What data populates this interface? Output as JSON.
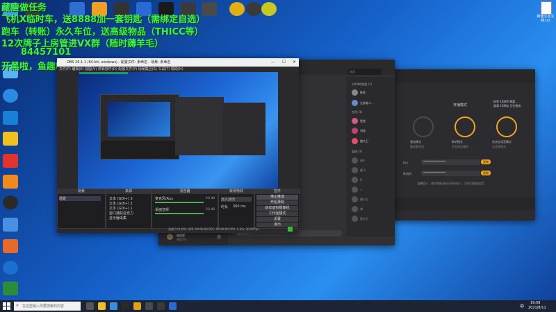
{
  "overlay": {
    "line1": "藏瘦做任务",
    "line2": "飞机X临时车，送8888加一套钥匙（需绑定自选）",
    "line3": "跑车（转账）永久车位，送高级物品（THICC等）",
    "line4": "12次牌子上房管进VX群（随时薅羊毛）",
    "line5": "84457101",
    "line6": "开黑啦，鱼趣啦啦鱼104"
  },
  "desktop_icons_left": [
    {
      "label": "",
      "color": "#3aa0e8"
    },
    {
      "label": "",
      "color": "#5ab4f0"
    },
    {
      "label": "",
      "color": "#1a7fd6"
    },
    {
      "label": "",
      "color": "#f0c020"
    },
    {
      "label": "",
      "color": "#e2332c"
    },
    {
      "label": "",
      "color": "#f08a20"
    },
    {
      "label": "",
      "color": "#2a2a2a"
    },
    {
      "label": "",
      "color": "#4a90e2"
    },
    {
      "label": "",
      "color": "#e86a2a"
    },
    {
      "label": "",
      "color": "#1a6fd0"
    },
    {
      "label": "",
      "color": "#2d8c3c"
    }
  ],
  "desktop_icons_top": [
    {
      "label": "",
      "color": "#e0b010"
    },
    {
      "label": "",
      "color": "#3a3a3a"
    },
    {
      "label": "",
      "color": "#c82020"
    },
    {
      "label": "",
      "color": "#ffffff"
    }
  ],
  "desktop_icon_right": {
    "label": "新建文本文档.txt"
  },
  "obs": {
    "title": "OBS 26.1.1 (64-bit, windows) - 配置文件: 未命名 - 场景: 未命名",
    "menu": "文件(F) 编辑(E) 视图(V) 停靠部件(D) 配置文件(P) 场景集合(S) 工具(T) 帮助(H)",
    "scenes_header": "场景",
    "sources_header": "来源",
    "mixer_header": "混音器",
    "transitions_header": "转场特效",
    "controls_header": "控件",
    "scene_item": "场景",
    "sources": [
      "文本 (GDI+) 3",
      "文本 (GDI+) 2",
      "文本 (GDI+) 1",
      "窗口捕获亚克力",
      "显示器采集"
    ],
    "mixer_tracks": [
      "麦克风/Aux",
      "桌面音频"
    ],
    "mixer_levels": [
      "0.0 dB",
      "0.0 dB"
    ],
    "transition": "淡入淡出",
    "duration_label": "时长",
    "duration_value": "300 ms",
    "controls": [
      "停止推流",
      "开始录制",
      "启动虚拟摄像机",
      "工作室模式",
      "设置",
      "退出"
    ],
    "status": "丢帧 0 (0.0%)   LIVE: 00:00:00   REC: 00:00:00   CPU: 2.4%, 30.00 fps",
    "no_source": "未选择源"
  },
  "kaiheila": {
    "search_placeholder": "搜索",
    "groups": [
      {
        "title": "1000的频道 (2)",
        "members": [
          "陈鱼",
          "江苏省人..."
        ]
      },
      {
        "title": "在线 (3)",
        "members": [
          "鱼鱼",
          "刘桂",
          "猫大卫"
        ]
      },
      {
        "title": "离线 (7)",
        "members": [
          "老A",
          "姜飞",
          "R",
          "一",
          "黄小月",
          "海",
          "鱼大王"
        ]
      }
    ],
    "input_placeholder": "说点什么...",
    "user_name": "陈提提",
    "user_id": "#6274"
  },
  "voice": {
    "top_label": "开播模式",
    "modes": [
      "强化模式",
      "聆听模式",
      "发送全语音模式"
    ],
    "mode_subtitles": [
      "重启麦克风",
      "不会发出噪声",
      "全语音模式"
    ],
    "token_label": "key",
    "token_value": "****************",
    "addr_label": "推流码",
    "addr_value": "****************",
    "copy_btn": "复制",
    "note": "温馨提示：请勿将推流码分享给他人，否则可能被盗用",
    "rate_label": "码率 1080P 需要...",
    "rate_sub": "超清 1080p 正在推流"
  },
  "taskbar": {
    "search_placeholder": "在这里输入你要搜索的内容",
    "time": "19:58",
    "date": "2021/8/11",
    "lang": "中"
  },
  "colors": {
    "accent_orange": "#f3a51b",
    "overlay_green": "#3cf24a",
    "dark_bg": "#2b2b2e"
  }
}
